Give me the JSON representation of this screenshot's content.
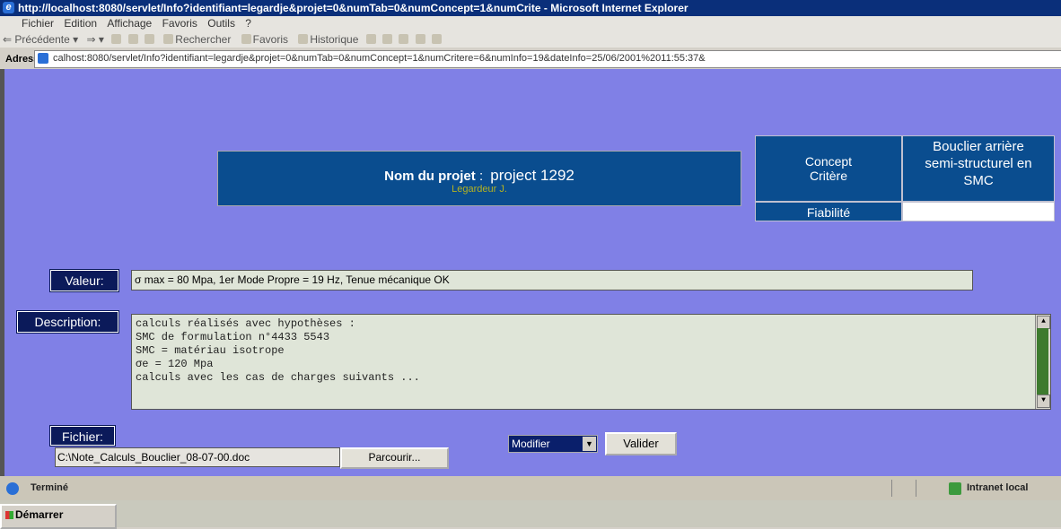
{
  "window": {
    "title": "http://localhost:8080/servlet/Info?identifiant=legardje&projet=0&numTab=0&numConcept=1&numCrite - Microsoft Internet Explorer"
  },
  "menu": [
    "Fichier",
    "Edition",
    "Affichage",
    "Favoris",
    "Outils",
    "?"
  ],
  "toolbar": {
    "back": "Précédente",
    "search": "Rechercher",
    "favorites": "Favoris",
    "history": "Historique"
  },
  "address": {
    "label": "Adresse",
    "url": "calhost:8080/servlet/Info?identifiant=legardje&projet=0&numTab=0&numConcept=1&numCritere=6&numInfo=19&dateInfo=25/06/2001%2011:55:37&"
  },
  "project": {
    "label": "Nom du projet",
    "separator": " : ",
    "name": "project 1292",
    "owner": "Legardeur J."
  },
  "concept": {
    "line1": "Concept",
    "line2": "Critère",
    "value_line1": "Bouclier arrière",
    "value_line2": "semi-structurel en",
    "value_line3": "SMC",
    "criterion_label": "Fiabilité",
    "criterion_value": ""
  },
  "form": {
    "valeur_label": "Valeur:",
    "valeur": "σ max = 80 Mpa, 1er Mode Propre = 19 Hz, Tenue mécanique OK",
    "description_label": "Description:",
    "description_lines": [
      "calculs réalisés avec hypothèses :",
      "SMC de formulation n°4433 5543",
      "SMC = matériau isotrope",
      "σe = 120 Mpa",
      "calculs avec les cas de charges suivants ..."
    ],
    "fichier_label": "Fichier:",
    "fichier": "C:\\Note_Calculs_Bouclier_08-07-00.doc",
    "browse_label": "Parcourir...",
    "action_select": "Modifier",
    "submit_label": "Valider"
  },
  "status": {
    "text": "Terminé",
    "zone": "Intranet local"
  },
  "taskbar": {
    "start_label": "Démarrer"
  }
}
